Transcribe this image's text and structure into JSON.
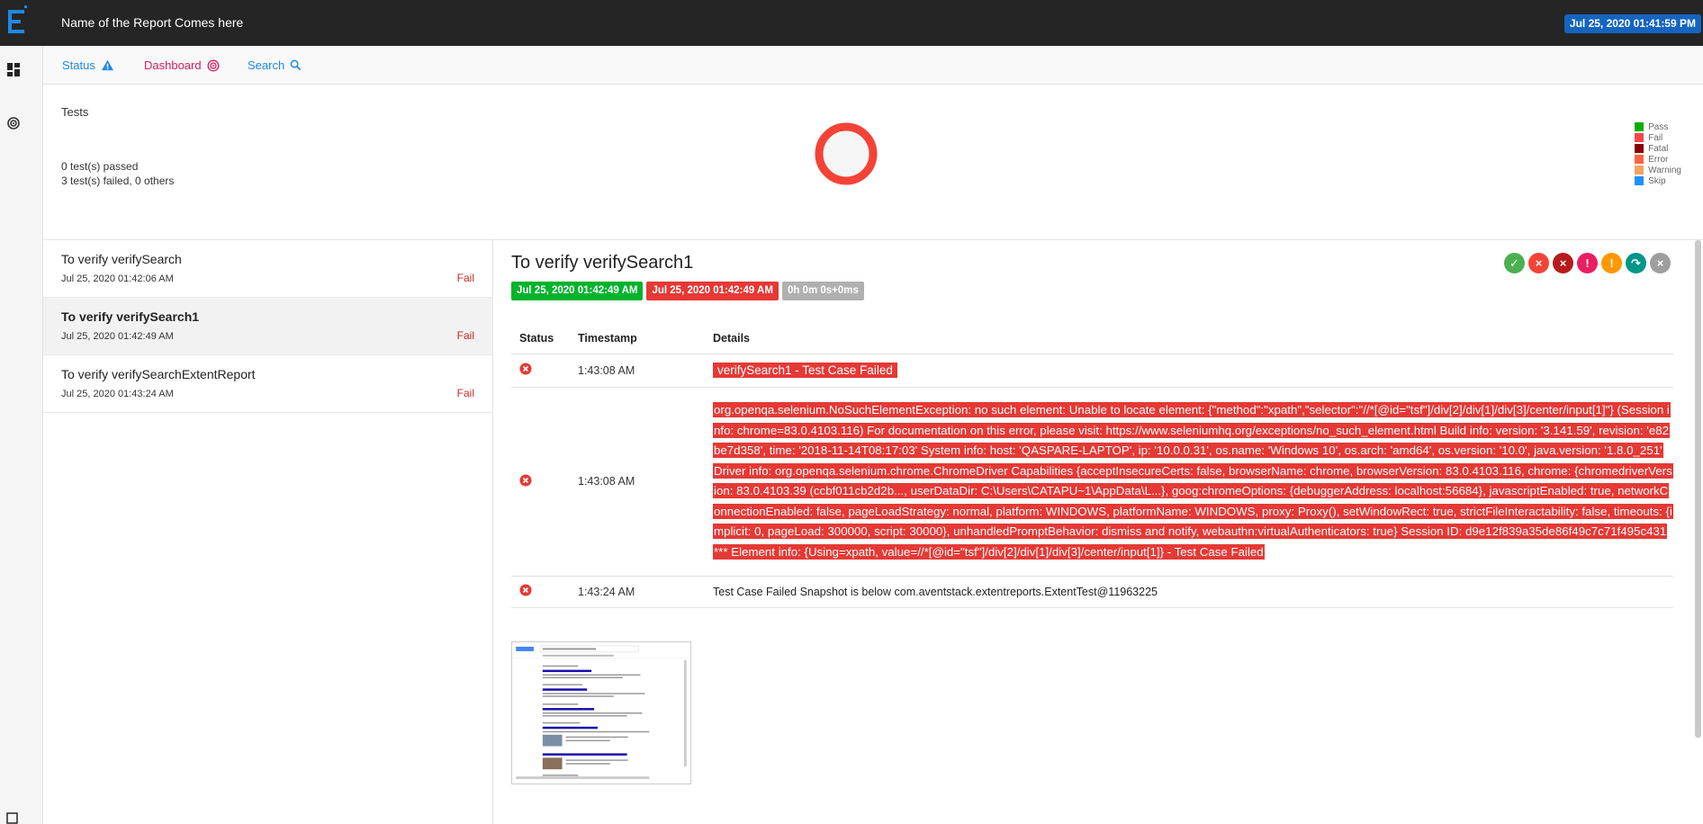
{
  "header": {
    "report_name": "Name of the Report Comes here",
    "date": "Jul 25, 2020 01:41:59 PM"
  },
  "rail": {
    "icons": [
      "dashboard-grid-icon",
      "target-icon",
      "square-icon"
    ]
  },
  "tabs": [
    {
      "label": "Status",
      "icon": "warning-triangle-icon",
      "color": "#1e88e5"
    },
    {
      "label": "Dashboard",
      "icon": "target-icon",
      "color": "#d81b60"
    },
    {
      "label": "Search",
      "icon": "search-icon",
      "color": "#1e88e5"
    }
  ],
  "dashboard": {
    "title": "Tests",
    "passed_text": "0 test(s) passed",
    "failed_text": "3 test(s) failed, 0 others",
    "donut": {
      "fail": 3,
      "pass": 0,
      "color": "#f44336"
    },
    "legend": [
      {
        "label": "Pass",
        "color": "#00af00"
      },
      {
        "label": "Fail",
        "color": "#f7464a"
      },
      {
        "label": "Fatal",
        "color": "#8b0000"
      },
      {
        "label": "Error",
        "color": "#ff6347"
      },
      {
        "label": "Warning",
        "color": "#f5a35f"
      },
      {
        "label": "Skip",
        "color": "#1e90ff"
      }
    ]
  },
  "tests": [
    {
      "name": "To verify verifySearch",
      "time": "Jul 25, 2020 01:42:06 AM",
      "status": "Fail"
    },
    {
      "name": "To verify verifySearch1",
      "time": "Jul 25, 2020 01:42:49 AM",
      "status": "Fail"
    },
    {
      "name": "To verify verifySearchExtentReport",
      "time": "Jul 25, 2020 01:43:24 AM",
      "status": "Fail"
    }
  ],
  "detail": {
    "title": "To verify verifySearch1",
    "start": "Jul 25, 2020 01:42:49 AM",
    "end": "Jul 25, 2020 01:42:49 AM",
    "duration": "0h 0m 0s+0ms",
    "filters": [
      {
        "name": "pass-filter-icon",
        "color": "#4caf50",
        "glyph": "✓"
      },
      {
        "name": "fail-filter-icon",
        "color": "#f44336",
        "glyph": "×"
      },
      {
        "name": "fatal-filter-icon",
        "color": "#b71c1c",
        "glyph": "×"
      },
      {
        "name": "error-filter-icon",
        "color": "#e91e63",
        "glyph": "!"
      },
      {
        "name": "warning-filter-icon",
        "color": "#ff9800",
        "glyph": "!"
      },
      {
        "name": "skip-filter-icon",
        "color": "#009688",
        "glyph": "↷"
      },
      {
        "name": "clear-filter-icon",
        "color": "#9e9e9e",
        "glyph": "×"
      }
    ],
    "log_headers": {
      "status": "Status",
      "timestamp": "Timestamp",
      "details": "Details"
    },
    "logs": [
      {
        "time": "1:43:08 AM",
        "details": "verifySearch1 - Test Case Failed"
      },
      {
        "time": "1:43:08 AM",
        "details": "org.openqa.selenium.NoSuchElementException: no such element: Unable to locate element: {\"method\":\"xpath\",\"selector\":\"//*[@id=\"tsf\"]/div[2]/div[1]/div[3]/center/input[1]\"} (Session info: chrome=83.0.4103.116) For documentation on this error, please visit: https://www.seleniumhq.org/exceptions/no_such_element.html Build info: version: '3.141.59', revision: 'e82be7d358', time: '2018-11-14T08:17:03' System info: host: 'QASPARE-LAPTOP', ip: '10.0.0.31', os.name: 'Windows 10', os.arch: 'amd64', os.version: '10.0', java.version: '1.8.0_251' Driver info: org.openqa.selenium.chrome.ChromeDriver Capabilities {acceptInsecureCerts: false, browserName: chrome, browserVersion: 83.0.4103.116, chrome: {chromedriverVersion: 83.0.4103.39 (ccbf011cb2d2b..., userDataDir: C:\\Users\\CATAPU~1\\AppData\\L...}, goog:chromeOptions: {debuggerAddress: localhost:56684}, javascriptEnabled: true, networkConnectionEnabled: false, pageLoadStrategy: normal, platform: WINDOWS, platformName: WINDOWS, proxy: Proxy(), setWindowRect: true, strictFileInteractability: false, timeouts: {implicit: 0, pageLoad: 300000, script: 30000}, unhandledPromptBehavior: dismiss and notify, webauthn:virtualAuthenticators: true} Session ID: d9e12f839a35de86f49c7c71f495c431 *** Element info: {Using=xpath, value=//*[@id=\"tsf\"]/div[2]/div[1]/div[3]/center/input[1]} - Test Case Failed"
      },
      {
        "time": "1:43:24 AM",
        "details": "Test Case Failed Snapshot is below com.aventstack.extentreports.ExtentTest@11963225"
      }
    ]
  }
}
